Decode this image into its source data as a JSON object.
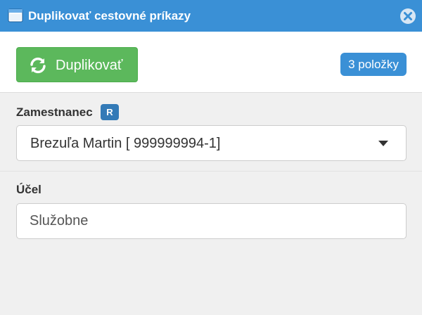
{
  "window": {
    "title": "Duplikovať cestovné príkazy",
    "icon": "window-icon",
    "close_icon": "close-icon"
  },
  "toolbar": {
    "duplicate_label": "Duplikovať",
    "duplicate_icon": "refresh-icon",
    "count_badge": "3 položky"
  },
  "form": {
    "employee": {
      "label": "Zamestnanec",
      "badge": "R",
      "selected_value": "Brezuľa Martin [ 999999994-1]"
    },
    "purpose": {
      "label": "Účel",
      "value": "Služobne"
    }
  },
  "colors": {
    "titlebar": "#3a90d6",
    "primary_button": "#5cb85c",
    "count_badge": "#3a90d6",
    "r_badge": "#337ab7",
    "background": "#f0f0f0"
  }
}
